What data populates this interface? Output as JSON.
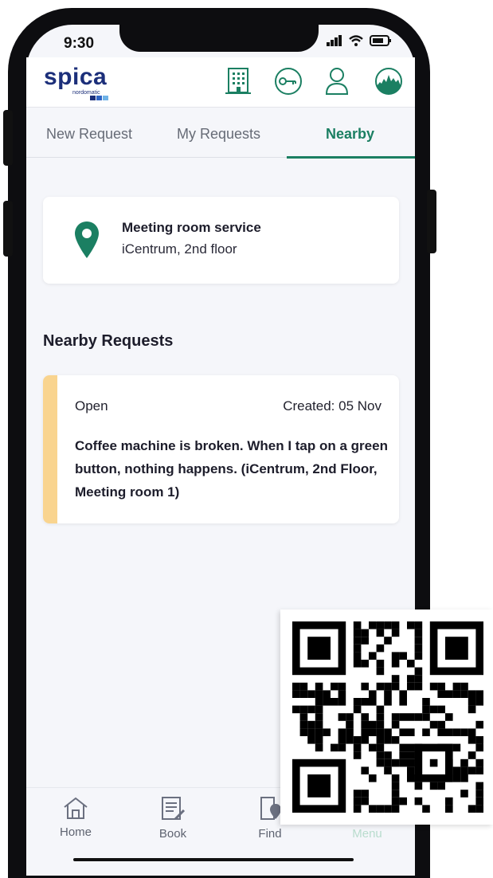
{
  "status_bar": {
    "time": "9:30"
  },
  "header": {
    "logo": "spica",
    "logo_sub": "nordomatic"
  },
  "tabs": [
    {
      "label": "New Request"
    },
    {
      "label": "My Requests"
    },
    {
      "label": "Nearby"
    }
  ],
  "service": {
    "title": "Meeting room service",
    "location": "iCentrum, 2nd floor"
  },
  "nearby": {
    "title": "Nearby Requests",
    "requests": [
      {
        "status": "Open",
        "created": "Created: 05 Nov",
        "description": "Coffee machine is broken. When I tap on a green button, nothing happens. (iCentrum, 2nd Floor, Meeting room 1)"
      }
    ]
  },
  "bottom_nav": [
    {
      "label": "Home"
    },
    {
      "label": "Book"
    },
    {
      "label": "Find"
    },
    {
      "label": "Menu"
    }
  ],
  "colors": {
    "accent": "#1b7f62",
    "brand": "#1c2f7a",
    "open_status": "#f9d48f"
  }
}
